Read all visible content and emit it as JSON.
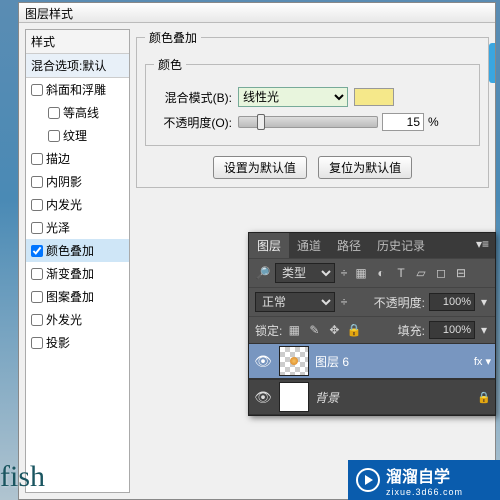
{
  "window": {
    "title": "图层样式"
  },
  "sidebar": {
    "header": "样式",
    "sub": "混合选项:默认",
    "items": [
      {
        "label": "斜面和浮雕",
        "checked": false,
        "indent": 0
      },
      {
        "label": "等高线",
        "checked": false,
        "indent": 1
      },
      {
        "label": "纹理",
        "checked": false,
        "indent": 1
      },
      {
        "label": "描边",
        "checked": false,
        "indent": 0
      },
      {
        "label": "内阴影",
        "checked": false,
        "indent": 0
      },
      {
        "label": "内发光",
        "checked": false,
        "indent": 0
      },
      {
        "label": "光泽",
        "checked": false,
        "indent": 0
      },
      {
        "label": "颜色叠加",
        "checked": true,
        "indent": 0,
        "selected": true
      },
      {
        "label": "渐变叠加",
        "checked": false,
        "indent": 0
      },
      {
        "label": "图案叠加",
        "checked": false,
        "indent": 0
      },
      {
        "label": "外发光",
        "checked": false,
        "indent": 0
      },
      {
        "label": "投影",
        "checked": false,
        "indent": 0
      }
    ]
  },
  "main": {
    "group_title": "颜色叠加",
    "inner_title": "颜色",
    "blend_label": "混合模式(B):",
    "blend_value": "线性光",
    "opacity_label": "不透明度(O):",
    "opacity_value": "15",
    "opacity_unit": "%",
    "btn_default": "设置为默认值",
    "btn_reset": "复位为默认值",
    "swatch_color": "#f5e88a"
  },
  "panel": {
    "tabs": [
      "图层",
      "通道",
      "路径",
      "历史记录"
    ],
    "active_tab": 0,
    "kind": "类型",
    "blend_mode": "正常",
    "opacity_label": "不透明度:",
    "opacity_value": "100%",
    "lock_label": "锁定:",
    "fill_label": "填充:",
    "fill_value": "100%",
    "layers": [
      {
        "name": "图层 6",
        "visible": true,
        "selected": true,
        "fx": "fx",
        "checker": true
      },
      {
        "name": "背景",
        "visible": true,
        "selected": false,
        "locked": true,
        "checker": false
      }
    ]
  },
  "fish": "fish",
  "watermark": {
    "brand": "溜溜自学",
    "url": "zixue.3d66.com"
  }
}
